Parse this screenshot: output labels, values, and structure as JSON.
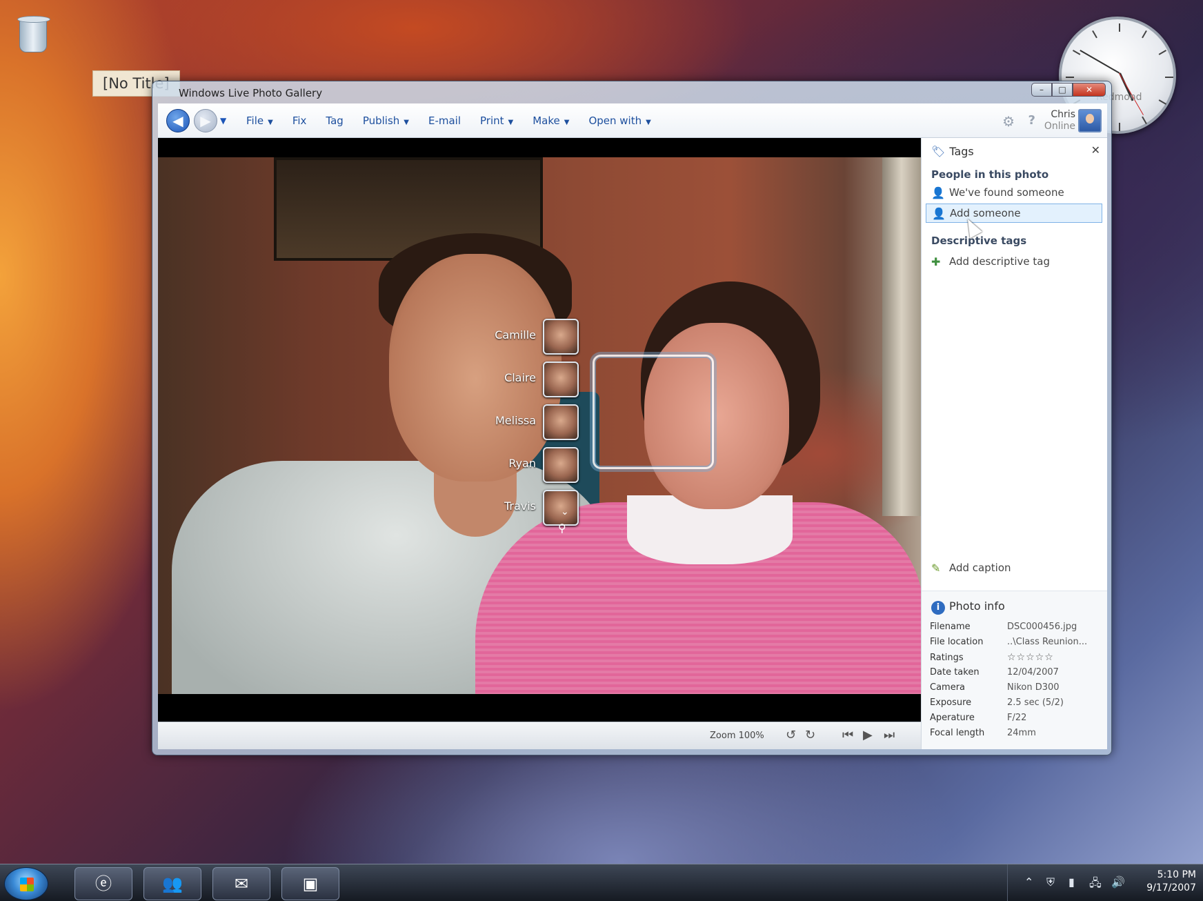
{
  "desktop": {
    "notitle_label": "[No Title]",
    "clock_label": "Redmond"
  },
  "window": {
    "title": "Windows Live Photo Gallery",
    "buttons": {
      "minimize": "–",
      "maximize": "□",
      "close": "✕"
    }
  },
  "toolbar": {
    "menu": [
      {
        "label": "File",
        "has_arrow": true
      },
      {
        "label": "Fix",
        "has_arrow": false
      },
      {
        "label": "Tag",
        "has_arrow": false
      },
      {
        "label": "Publish",
        "has_arrow": true
      },
      {
        "label": "E-mail",
        "has_arrow": false
      },
      {
        "label": "Print",
        "has_arrow": true
      },
      {
        "label": "Make",
        "has_arrow": true
      },
      {
        "label": "Open with",
        "has_arrow": true
      }
    ],
    "user_name": "Chris",
    "user_status": "Online"
  },
  "people_suggestions": [
    "Camille",
    "Claire",
    "Melissa",
    "Ryan",
    "Travis"
  ],
  "status_bar": {
    "zoom": "Zoom 100%"
  },
  "pane": {
    "title": "Tags",
    "people_header": "People in this photo",
    "found_someone": "We've found someone",
    "add_someone": "Add someone",
    "descriptive_header": "Descriptive tags",
    "add_descriptive": "Add descriptive tag",
    "add_caption": "Add caption"
  },
  "photo_info": {
    "title": "Photo info",
    "rows": [
      {
        "key": "Filename",
        "value": "DSC000456.jpg"
      },
      {
        "key": "File location",
        "value": "..\\Class Reunion..."
      },
      {
        "key": "Ratings",
        "value": "☆☆☆☆☆"
      },
      {
        "key": "Date taken",
        "value": "12/04/2007"
      },
      {
        "key": "Camera",
        "value": "Nikon D300"
      },
      {
        "key": "Exposure",
        "value": "2.5 sec (5/2)"
      },
      {
        "key": "Aperature",
        "value": "F/22"
      },
      {
        "key": "Focal length",
        "value": "24mm"
      }
    ]
  },
  "taskbar": {
    "time": "5:10 PM",
    "date": "9/17/2007"
  },
  "colors": {
    "accent": "#1d4f9e",
    "selection": "#e3f1fd"
  }
}
